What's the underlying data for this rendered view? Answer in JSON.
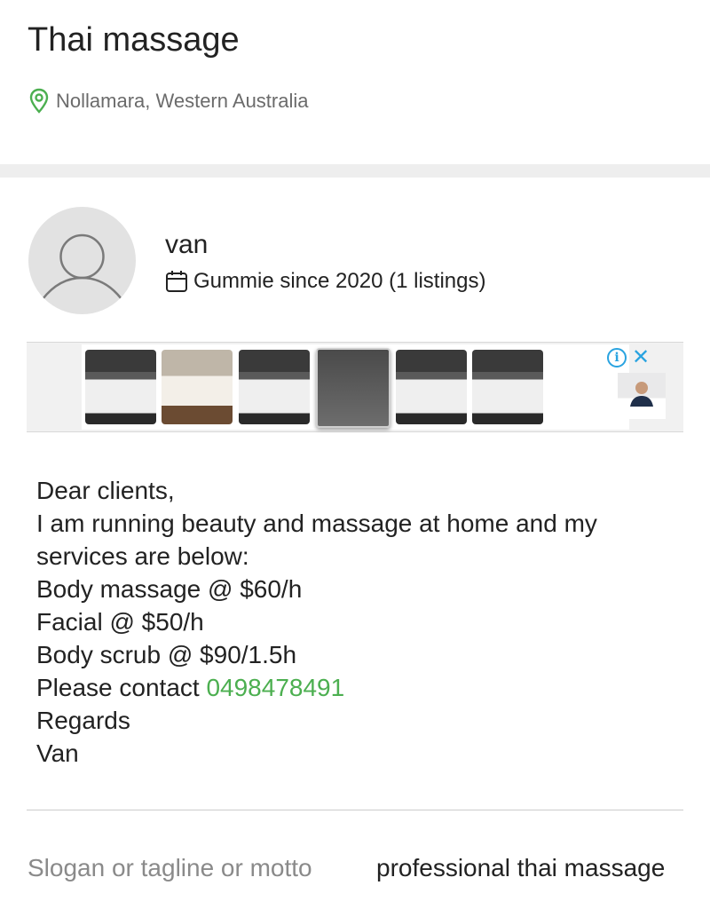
{
  "listing": {
    "title": "Thai massage",
    "location": "Nollamara, Western Australia",
    "location_icon": "location-pin-icon"
  },
  "seller": {
    "name": "van",
    "member_text": "Gummie since 2020 (1 listings)",
    "member_icon": "calendar-icon",
    "avatar_icon": "user-placeholder-icon"
  },
  "ad": {
    "info_icon": "info-icon",
    "close_icon": "close-icon",
    "close_glyph": "✕",
    "info_glyph": "i"
  },
  "description": {
    "lines": [
      "Dear clients,",
      "I am running beauty and massage at home and my",
      "services are below:",
      "Body massage @ $60/h",
      "Facial @ $50/h",
      "Body scrub @ $90/1.5h"
    ],
    "contact_prefix": "Please contact ",
    "phone": "0498478491",
    "closing": "Regards",
    "signature": "Van"
  },
  "attributes": {
    "slogan_label": "Slogan or tagline or motto",
    "slogan_value": "professional thai massage"
  },
  "colors": {
    "accent_green": "#4caf50",
    "ad_blue": "#29a3e0",
    "muted_text": "#6b6b6b"
  }
}
